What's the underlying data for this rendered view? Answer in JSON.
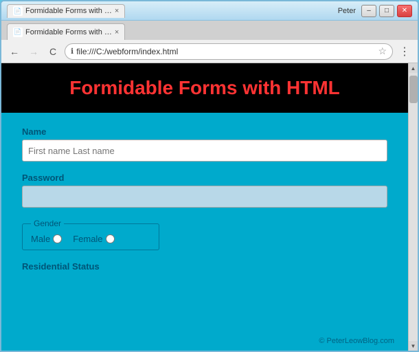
{
  "window": {
    "user_label": "Peter",
    "minimize_label": "–",
    "maximize_label": "□",
    "close_label": "✕"
  },
  "browser": {
    "tab_title": "Formidable Forms with …",
    "tab_close": "×",
    "nav_back": "←",
    "nav_forward": "→",
    "nav_refresh": "C",
    "address_icon": "ℹ",
    "address_url": "file:///C:/webform/index.html",
    "address_star": "☆",
    "menu_icon": "⋮"
  },
  "page": {
    "title": "Formidable Forms with HTML",
    "form": {
      "name_label": "Name",
      "name_placeholder": "First name Last name",
      "password_label": "Password",
      "password_value": "",
      "gender_legend": "Gender",
      "male_label": "Male",
      "female_label": "Female",
      "residential_label": "Residential Status"
    }
  },
  "copyright": "© PeterLeowBlog.com"
}
